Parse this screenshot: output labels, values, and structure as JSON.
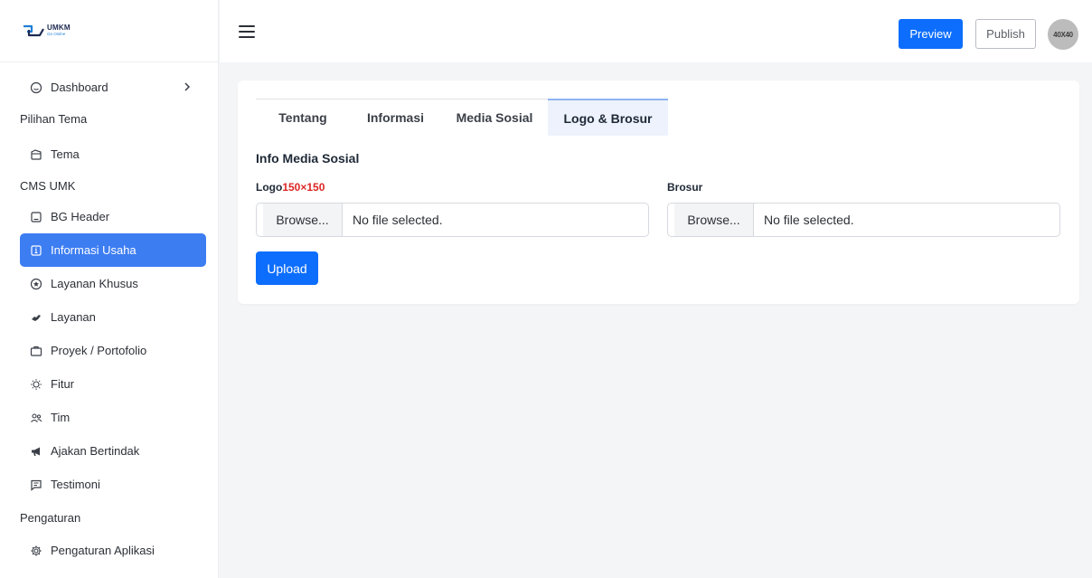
{
  "brand": {
    "name": "UMKM",
    "tagline": "Go Online"
  },
  "colors": {
    "primary": "#0d6efd",
    "active_nav": "#3d7df2",
    "required": "#dc2626"
  },
  "sidebar": {
    "items": [
      {
        "label": "Dashboard",
        "icon": "circle-icon"
      },
      {
        "section": "Pilihan Tema"
      },
      {
        "label": "Tema",
        "icon": "palette-icon"
      },
      {
        "section": "CMS UMK"
      },
      {
        "label": "BG Header",
        "icon": "image-icon"
      },
      {
        "label": "Informasi Usaha",
        "icon": "info-box-icon",
        "active": true
      },
      {
        "label": "Layanan Khusus",
        "icon": "star-circle-icon"
      },
      {
        "label": "Layanan",
        "icon": "handshake-icon"
      },
      {
        "label": "Proyek / Portofolio",
        "icon": "briefcase-icon"
      },
      {
        "label": "Fitur",
        "icon": "bulb-icon"
      },
      {
        "label": "Tim",
        "icon": "users-icon"
      },
      {
        "label": "Ajakan Bertindak",
        "icon": "megaphone-icon"
      },
      {
        "label": "Testimoni",
        "icon": "message-icon"
      },
      {
        "section": "Pengaturan"
      },
      {
        "label": "Pengaturan Aplikasi",
        "icon": "gear-icon"
      }
    ]
  },
  "topbar": {
    "preview_label": "Preview",
    "publish_label": "Publish",
    "avatar_text": "40X40"
  },
  "tabs": [
    {
      "label": "Tentang"
    },
    {
      "label": "Informasi"
    },
    {
      "label": "Media Sosial"
    },
    {
      "label": "Logo & Brosur",
      "active": true
    }
  ],
  "form": {
    "section_title": "Info Media Sosial",
    "logo_label": "Logo",
    "logo_size": "150×150",
    "brosur_label": "Brosur",
    "browse_label": "Browse...",
    "no_file_text": "No file selected.",
    "upload_label": "Upload"
  }
}
